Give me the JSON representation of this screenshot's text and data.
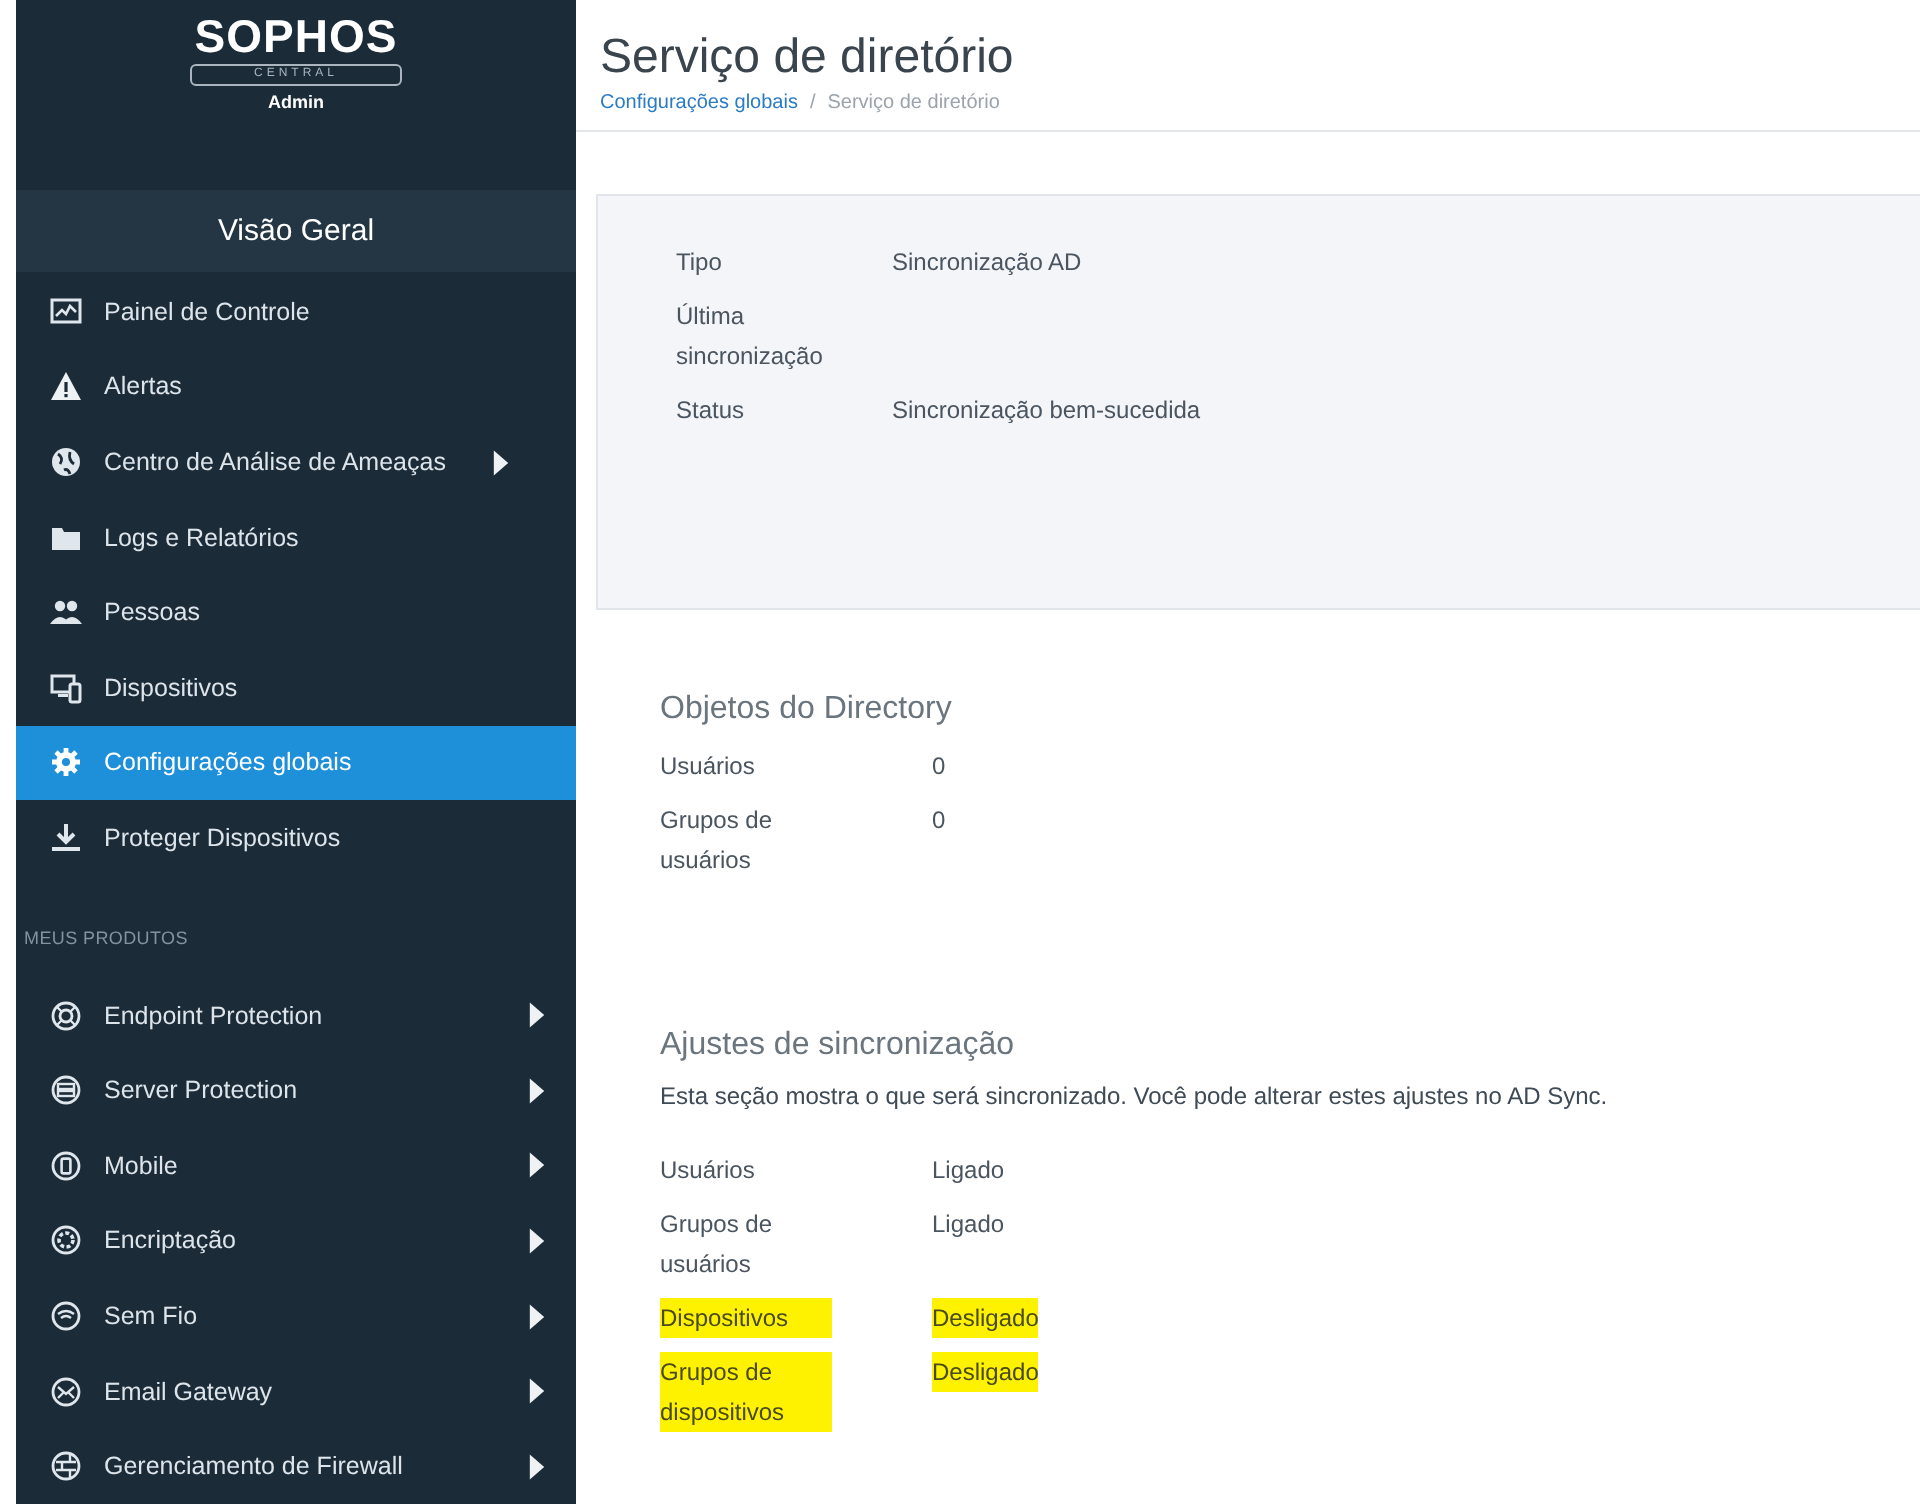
{
  "sidebar": {
    "logo": {
      "brand": "SOPHOS",
      "product": "CENTRAL",
      "role": "Admin"
    },
    "section_title": "Visão Geral",
    "items": [
      {
        "label": "Painel de Controle",
        "selected": false,
        "has_submenu": false
      },
      {
        "label": "Alertas",
        "selected": false,
        "has_submenu": false
      },
      {
        "label": "Centro de Análise de Ameaças",
        "selected": false,
        "has_submenu": true
      },
      {
        "label": "Logs e Relatórios",
        "selected": false,
        "has_submenu": false
      },
      {
        "label": "Pessoas",
        "selected": false,
        "has_submenu": false
      },
      {
        "label": "Dispositivos",
        "selected": false,
        "has_submenu": false
      },
      {
        "label": "Configurações globais",
        "selected": true,
        "has_submenu": false
      },
      {
        "label": "Proteger Dispositivos",
        "selected": false,
        "has_submenu": false
      }
    ],
    "products_heading": "MEUS PRODUTOS",
    "products": [
      {
        "label": "Endpoint Protection",
        "selected": false,
        "has_submenu": true
      },
      {
        "label": "Server Protection",
        "selected": false,
        "has_submenu": true
      },
      {
        "label": "Mobile",
        "selected": false,
        "has_submenu": true
      },
      {
        "label": "Encriptação",
        "selected": false,
        "has_submenu": true
      },
      {
        "label": "Sem Fio",
        "selected": false,
        "has_submenu": true
      },
      {
        "label": "Email Gateway",
        "selected": false,
        "has_submenu": true
      },
      {
        "label": "Gerenciamento de Firewall",
        "selected": false,
        "has_submenu": true
      }
    ]
  },
  "page": {
    "title": "Serviço de diretório",
    "breadcrumb_separator": "/",
    "breadcrumb": [
      {
        "label": "Configurações globais",
        "kind": "link"
      },
      {
        "label": "Serviço de diretório",
        "kind": "current"
      }
    ]
  },
  "summary": [
    {
      "label": "Tipo",
      "value": "Sincronização AD"
    },
    {
      "label": "Última sincronização"
    },
    {
      "label": "Status",
      "value": "Sincronização bem-sucedida"
    }
  ],
  "sections": [
    {
      "title": "Objetos do Directory",
      "rows": [
        {
          "label": "Usuários",
          "value": "0",
          "highlighted": false
        },
        {
          "label": "Grupos de usuários",
          "value": "0",
          "highlighted": false
        }
      ]
    },
    {
      "title": "Ajustes de sincronização",
      "description": "Esta seção mostra o que será sincronizado. Você pode alterar estes ajustes no AD Sync.",
      "rows": [
        {
          "label": "Usuários",
          "value": "Ligado",
          "highlighted": false
        },
        {
          "label": "Grupos de usuários",
          "value": "Ligado",
          "highlighted": false
        },
        {
          "label": "Dispositivos",
          "value": "Desligado",
          "highlighted": true
        },
        {
          "label": "Grupos de dispositivos",
          "value": "Desligado",
          "highlighted": true
        }
      ]
    }
  ]
}
